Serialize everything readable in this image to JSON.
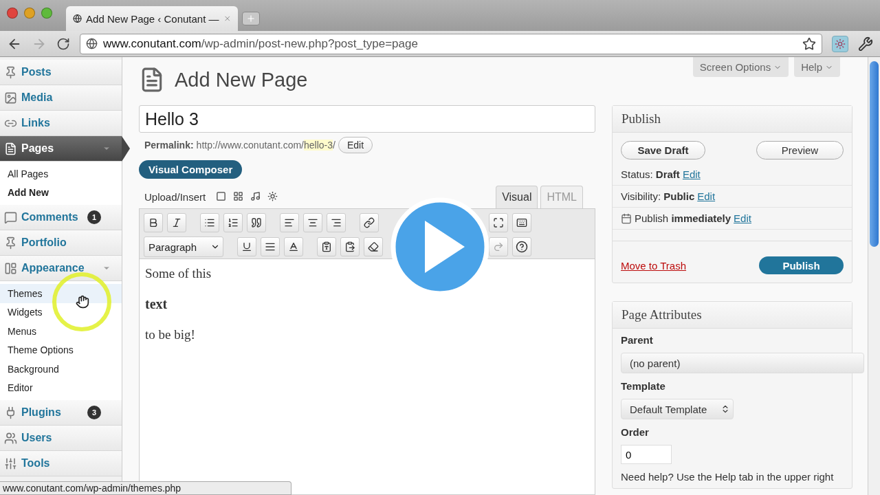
{
  "browser": {
    "tab_title": "Add New Page ‹ Conutant —",
    "url_host": "www.conutant.com",
    "url_path": "/wp-admin/post-new.php?post_type=page"
  },
  "sidebar": {
    "items": [
      {
        "label": "Posts",
        "selected": false
      },
      {
        "label": "Media",
        "selected": false
      },
      {
        "label": "Links",
        "selected": false
      },
      {
        "label": "Pages",
        "selected": true,
        "expanded": true,
        "children": [
          {
            "label": "All Pages",
            "selected": false,
            "hovered": false
          },
          {
            "label": "Add New",
            "selected": true,
            "hovered": false
          }
        ]
      },
      {
        "label": "Comments",
        "selected": false,
        "badge": "1"
      },
      {
        "label": "Portfolio",
        "selected": false
      },
      {
        "label": "Appearance",
        "selected": false,
        "expanded": true,
        "children": [
          {
            "label": "Themes",
            "selected": false,
            "hovered": true
          },
          {
            "label": "Widgets",
            "selected": false,
            "hovered": false
          },
          {
            "label": "Menus",
            "selected": false,
            "hovered": false
          },
          {
            "label": "Theme Options",
            "selected": false,
            "hovered": false
          },
          {
            "label": "Background",
            "selected": false,
            "hovered": false
          },
          {
            "label": "Editor",
            "selected": false,
            "hovered": false
          }
        ]
      },
      {
        "label": "Plugins",
        "selected": false,
        "badge": "3"
      },
      {
        "label": "Users",
        "selected": false
      },
      {
        "label": "Tools",
        "selected": false
      }
    ]
  },
  "header": {
    "title": "Add New Page",
    "screen_options": "Screen Options",
    "help": "Help"
  },
  "editor": {
    "title_value": "Hello 3",
    "permalink_label": "Permalink:",
    "permalink_base": "http://www.conutant.com/",
    "permalink_slug": "hello-3",
    "permalink_end": "/",
    "permalink_edit": "Edit",
    "visual_composer": "Visual Composer",
    "upload_insert": "Upload/Insert",
    "tabs": [
      {
        "label": "Visual",
        "selected": true
      },
      {
        "label": "HTML",
        "selected": false
      }
    ],
    "format": "Paragraph",
    "content": [
      {
        "kind": "p",
        "text": "Some of this"
      },
      {
        "kind": "bold",
        "text": "text"
      },
      {
        "kind": "p",
        "text": "to be big!"
      }
    ]
  },
  "publish": {
    "title": "Publish",
    "save_draft": "Save Draft",
    "preview": "Preview",
    "rows": [
      {
        "kind": "status",
        "text": "Status: **Draft**",
        "link": "Edit"
      },
      {
        "kind": "visibility",
        "text": "Visibility: **Public**",
        "link": "Edit"
      },
      {
        "kind": "schedule",
        "text": "Publish **immediately**",
        "link": "Edit"
      }
    ],
    "trash": "Move to Trash",
    "publish": "Publish"
  },
  "attributes": {
    "title": "Page Attributes",
    "parent_label": "Parent",
    "parent_value": "(no parent)",
    "template_label": "Template",
    "template_value": "Default Template",
    "order_label": "Order",
    "order_value": "0",
    "help": "Need help? Use the Help tab in the upper right"
  },
  "status_bar": "www.conutant.com/wp-admin/themes.php"
}
